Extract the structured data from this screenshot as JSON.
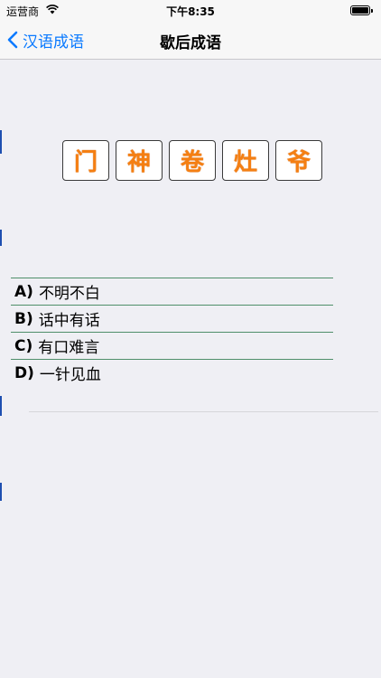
{
  "status_bar": {
    "carrier": "运营商",
    "time": "下午8:35",
    "battery_level": 1.0
  },
  "nav": {
    "back_label": "汉语成语",
    "title": "歇后成语"
  },
  "riddle": {
    "characters": [
      "门",
      "神",
      "卷",
      "灶",
      "爷"
    ]
  },
  "options": [
    {
      "key": "A)",
      "text": "不明不白"
    },
    {
      "key": "B)",
      "text": "话中有话"
    },
    {
      "key": "C)",
      "text": "有口难言"
    },
    {
      "key": "D)",
      "text": "一针见血"
    }
  ],
  "colors": {
    "accent": "#0a7aff",
    "tile_text": "#f57f12",
    "divider": "#4f8f6a",
    "background": "#efeff4"
  }
}
